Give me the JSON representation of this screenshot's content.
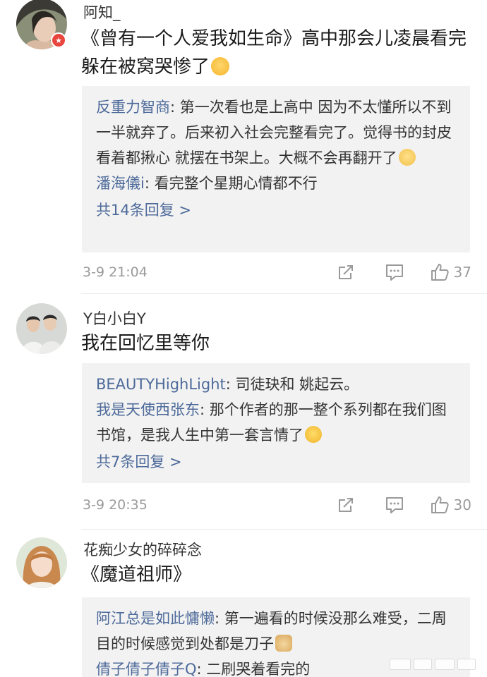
{
  "comments": [
    {
      "username": "阿知_",
      "text": "《曾有一个人爱我如生命》高中那会儿凌晨看完躲在被窝哭惨了",
      "replies": [
        {
          "name": "反重力智商",
          "text": ": 第一次看也是上高中 因为不太懂所以不到一半就弃了。后来初入社会完整看完了。觉得书的封皮看着都揪心 就摆在书架上。大概不会再翻开了"
        },
        {
          "name": "潘海儀i",
          "text": ": 看完整个星期心情都不行"
        }
      ],
      "more": "共14条回复 >",
      "time": "3-9 21:04",
      "likes": "37"
    },
    {
      "username": "Y白小白Y",
      "text": "我在回忆里等你",
      "replies": [
        {
          "name": "BEAUTYHighLight",
          "text": ": 司徒玦和 姚起云。"
        },
        {
          "name": "我是天使西张东",
          "text": ": 那个作者的那一整个系列都在我们图书馆，是我人生中第一套言情了"
        }
      ],
      "more": "共7条回复 >",
      "time": "3-9 20:35",
      "likes": "30"
    },
    {
      "username": "花痴少女的碎碎念",
      "text": "《魔道祖师》",
      "replies": [
        {
          "name": "阿江总是如此慵懒",
          "text": ": 第一遍看的时候没那么难受，二周目的时候感觉到处都是刀子"
        },
        {
          "name": "倩子倩子倩子Q",
          "text": ": 二刷哭着看完的"
        }
      ]
    }
  ],
  "icons": {
    "share": "share-icon",
    "comment": "comment-icon",
    "like": "thumbs-up-icon",
    "verified": "verified-badge-icon"
  },
  "colors": {
    "link": "#4d6a9a",
    "meta": "#9a9a9a",
    "reply_bg": "#f2f2f2",
    "badge": "#e8463f"
  }
}
